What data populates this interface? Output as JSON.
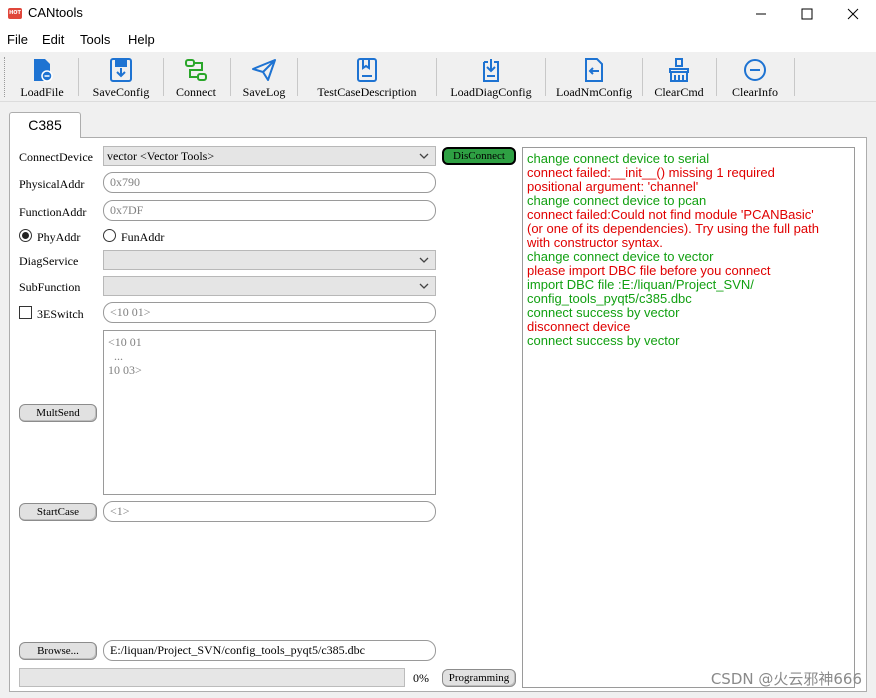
{
  "window": {
    "title": "CANtools",
    "icon_text": "HOT"
  },
  "menu": [
    "File",
    "Edit",
    "Tools",
    "Help"
  ],
  "toolbar": [
    {
      "label": "LoadFile",
      "icon": "load-file-icon"
    },
    {
      "label": "SaveConfig",
      "icon": "save-config-icon"
    },
    {
      "label": "Connect",
      "icon": "connect-icon"
    },
    {
      "label": "SaveLog",
      "icon": "paper-plane-icon"
    },
    {
      "label": "TestCaseDescription",
      "icon": "book-icon"
    },
    {
      "label": "LoadDiagConfig",
      "icon": "load-diag-icon"
    },
    {
      "label": "LoadNmConfig",
      "icon": "load-nm-icon"
    },
    {
      "label": "ClearCmd",
      "icon": "broom-icon"
    },
    {
      "label": "ClearInfo",
      "icon": "minus-circle-icon"
    }
  ],
  "tab": {
    "label": "C385"
  },
  "form": {
    "connect_device_label": "ConnectDevice",
    "connect_device_value": "vector <Vector Tools>",
    "physical_addr_label": "PhysicalAddr",
    "physical_addr_placeholder": "0x790",
    "function_addr_label": "FunctionAddr",
    "function_addr_placeholder": "0x7DF",
    "phy_addr_label": "PhyAddr",
    "fun_addr_label": "FunAddr",
    "diag_service_label": "DiagService",
    "diag_service_value": "",
    "sub_function_label": "SubFunction",
    "sub_function_value": "",
    "switch_3e_label": "3ESwitch",
    "switch_3e_placeholder": "<10 01>",
    "multi_text_placeholder": "<10 01\n  ...\n10 03>",
    "mult_send_label": "MultSend",
    "start_case_label": "StartCase",
    "start_case_placeholder": "<1>",
    "browse_label": "Browse...",
    "dbc_path": "E:/liquan/Project_SVN/config_tools_pyqt5/c385.dbc",
    "disconnect_label": "DisConnect",
    "programming_label": "Programming",
    "progress_percent": 0,
    "progress_text": "0%"
  },
  "log": [
    {
      "text": "change connect device to serial",
      "color": "#12a012"
    },
    {
      "text": "connect failed:__init__() missing 1 required",
      "color": "#e00000"
    },
    {
      "text": "positional argument: 'channel'",
      "color": "#e00000"
    },
    {
      "text": "change connect device to pcan",
      "color": "#12a012"
    },
    {
      "text": "connect failed:Could not find module 'PCANBasic'",
      "color": "#e00000"
    },
    {
      "text": "(or one of its dependencies). Try using the full path",
      "color": "#e00000"
    },
    {
      "text": "with constructor syntax.",
      "color": "#e00000"
    },
    {
      "text": "change connect device to vector",
      "color": "#12a012"
    },
    {
      "text": "please import DBC file before you connect",
      "color": "#e00000"
    },
    {
      "text": "import DBC file :E:/liquan/Project_SVN/",
      "color": "#12a012"
    },
    {
      "text": "config_tools_pyqt5/c385.dbc",
      "color": "#12a012"
    },
    {
      "text": "connect success by vector",
      "color": "#12a012"
    },
    {
      "text": "disconnect device",
      "color": "#e00000"
    },
    {
      "text": "connect success by vector",
      "color": "#12a012"
    }
  ],
  "watermark": "CSDN @火云邪神666"
}
